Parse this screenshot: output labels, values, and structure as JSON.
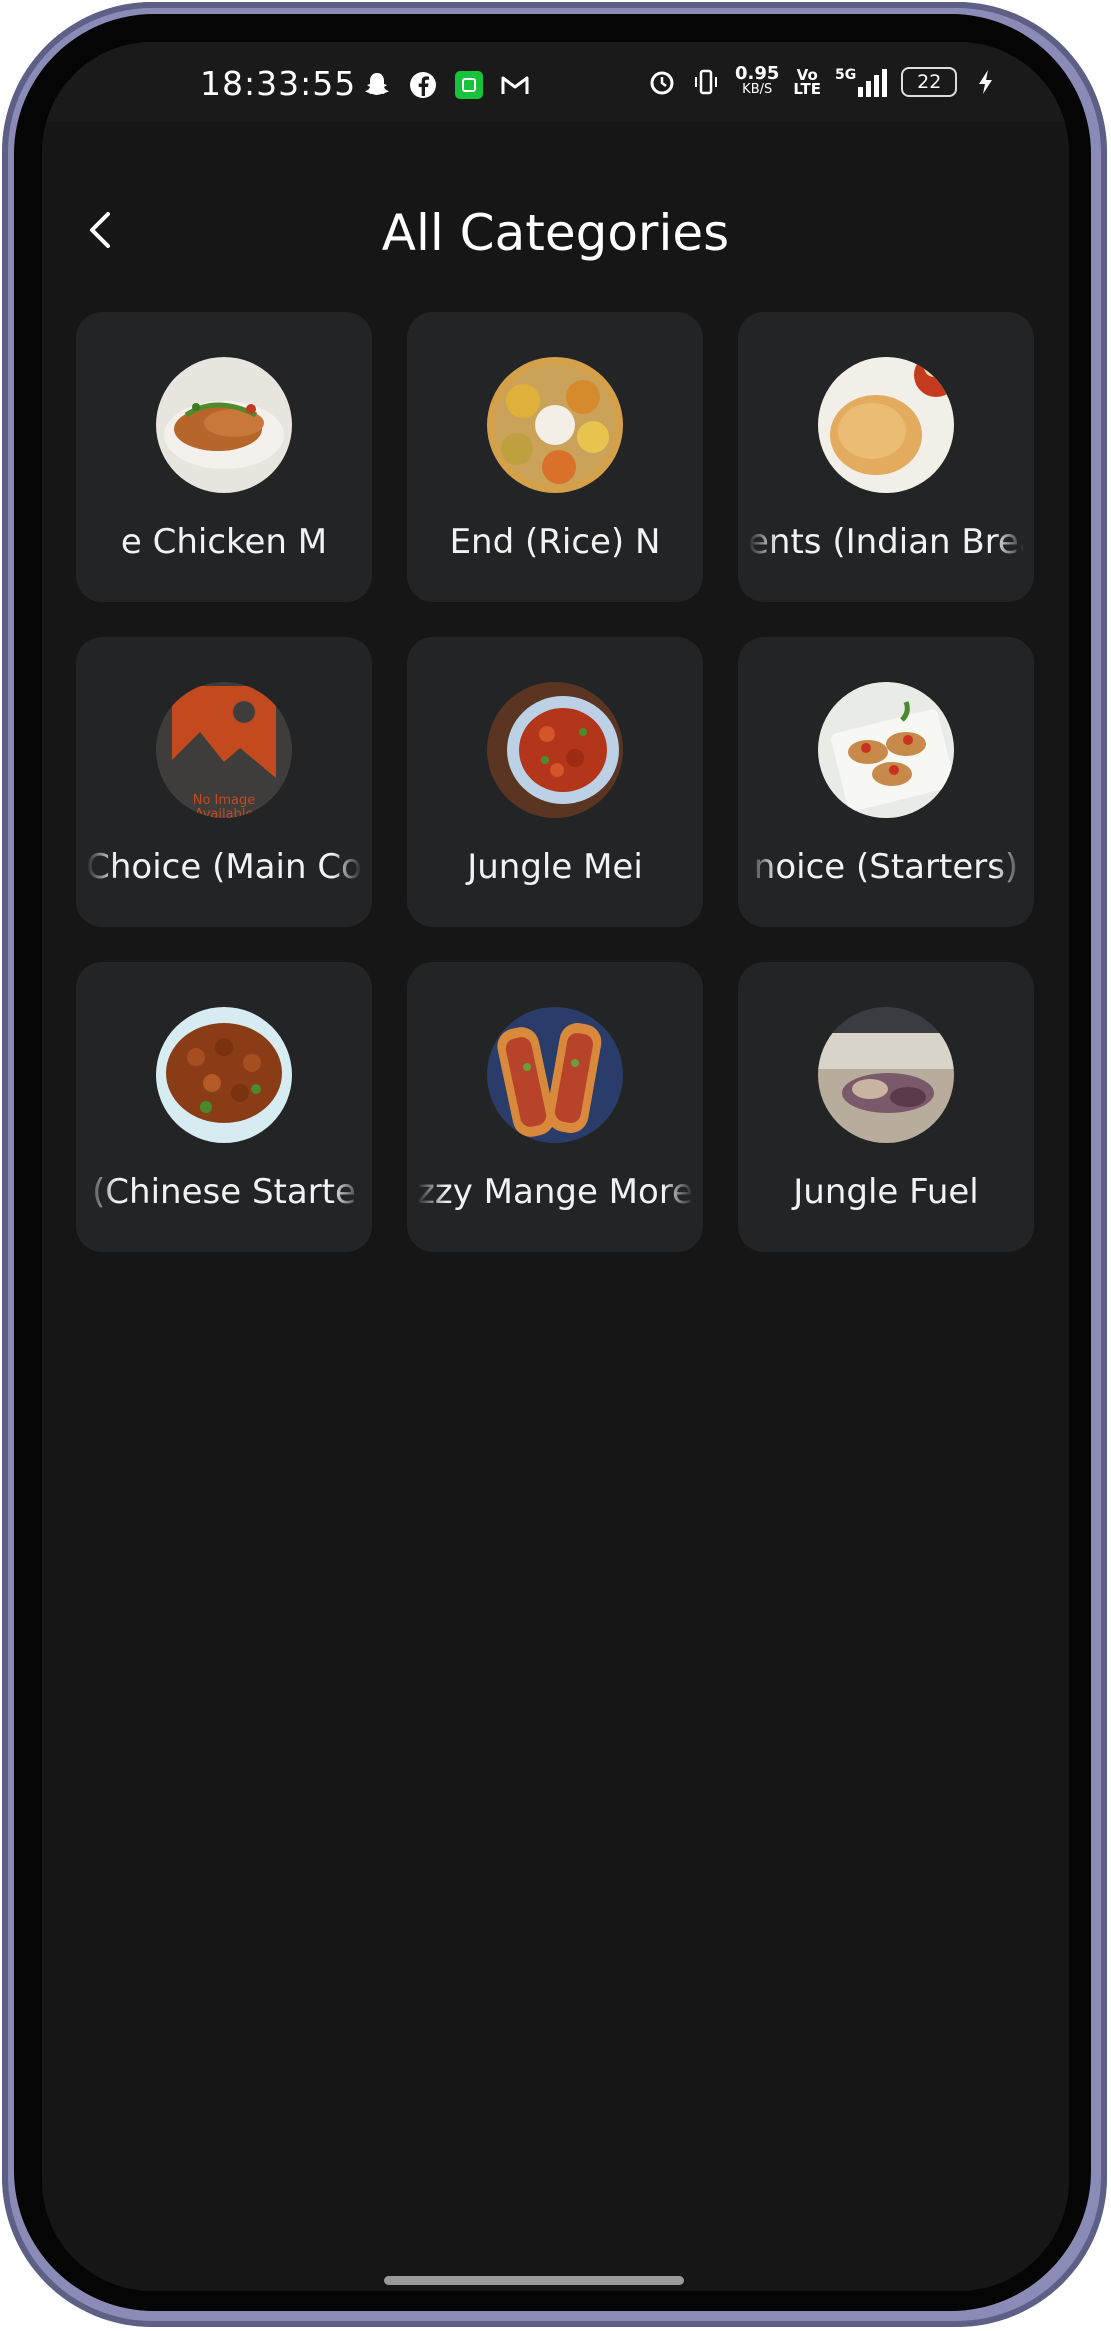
{
  "status_bar": {
    "time": "18:33:55",
    "net_speed": "0.95",
    "net_unit": "KB/S",
    "volte_top": "Vo",
    "volte_bottom": "LTE",
    "network": "5G",
    "battery": "22"
  },
  "header": {
    "title": "All Categories"
  },
  "categories": [
    {
      "label": "e      Chicken M",
      "thumb": "food-chicken"
    },
    {
      "label": "End (Rice)        N",
      "thumb": "food-thali"
    },
    {
      "label": "ents (Indian Brea",
      "thumb": "food-puri"
    },
    {
      "label": "Choice (Main Co",
      "thumb": "no-image"
    },
    {
      "label": "Jungle Mei",
      "thumb": "food-manchurian"
    },
    {
      "label": "noice (Starters)",
      "thumb": "food-bruschetta"
    },
    {
      "label": "(Chinese Starte",
      "thumb": "food-chilli-chicken"
    },
    {
      "label": "zzy Mange More",
      "thumb": "food-hotdogs"
    },
    {
      "label": "Jungle          Fuel",
      "thumb": "food-platter"
    }
  ],
  "placeholder": {
    "line1": "No Image",
    "line2": "Available"
  },
  "colors": {
    "background": "#161616",
    "card": "#232425",
    "text": "#ffffff",
    "placeholder": "#c24a1e"
  }
}
